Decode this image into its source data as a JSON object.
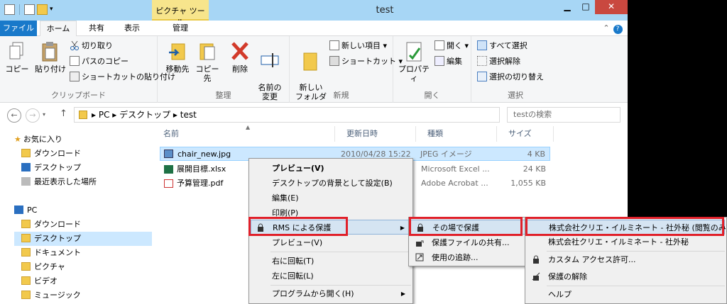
{
  "title": "test",
  "contextual_tab": "ピクチャ ツール",
  "tabs": {
    "file": "ファイル",
    "home": "ホーム",
    "share": "共有",
    "view": "表示",
    "manage": "管理"
  },
  "window_controls": {
    "minimize": "▁",
    "maximize": "□",
    "close": "✕"
  },
  "ribbon": {
    "clipboard": {
      "label": "クリップボード",
      "copy": "コピー",
      "paste": "貼り付け",
      "cut": "切り取り",
      "copy_path": "パスのコピー",
      "paste_shortcut": "ショートカットの貼り付け"
    },
    "organize": {
      "label": "整理",
      "move_to": "移動先",
      "copy_to": "コピー先",
      "delete": "削除",
      "rename": "名前の\n変更"
    },
    "new": {
      "label": "新規",
      "new_folder": "新しい\nフォルダー",
      "new_item": "新しい項目 ▾",
      "shortcut": "ショートカット ▾"
    },
    "open": {
      "label": "開く",
      "properties": "プロパティ",
      "open": "開く ▾",
      "edit": "編集"
    },
    "select": {
      "label": "選択",
      "select_all": "すべて選択",
      "select_none": "選択解除",
      "invert": "選択の切り替え"
    }
  },
  "address": {
    "path": "▸  PC  ▸  デスクトップ  ▸  test",
    "search_placeholder": "testの検索"
  },
  "nav": {
    "favorites": "お気に入り",
    "fav_items": [
      "ダウンロード",
      "デスクトップ",
      "最近表示した場所"
    ],
    "pc": "PC",
    "pc_items": [
      "ダウンロード",
      "デスクトップ",
      "ドキュメント",
      "ピクチャ",
      "ビデオ",
      "ミュージック"
    ]
  },
  "columns": {
    "name": "名前",
    "date": "更新日時",
    "type": "種類",
    "size": "サイズ"
  },
  "files": [
    {
      "name": "chair_new.jpg",
      "date": "2010/04/28 15:22",
      "type": "JPEG イメージ",
      "size": "4 KB"
    },
    {
      "name": "展開目標.xlsx",
      "date": "",
      "type": "Microsoft Excel ...",
      "size": "24 KB"
    },
    {
      "name": "予算管理.pdf",
      "date": "",
      "type": "Adobe Acrobat ...",
      "size": "1,055 KB"
    }
  ],
  "context_menu": [
    "プレビュー(V)",
    "デスクトップの背景として設定(B)",
    "編集(E)",
    "印刷(P)",
    "RMS による保護",
    "プレビュー(V)",
    "右に回転(T)",
    "左に回転(L)",
    "プログラムから開く(H)"
  ],
  "rms_menu": [
    "その場で保護",
    "保護ファイルの共有...",
    "使用の追跡..."
  ],
  "template_menu": [
    "株式会社クリエ・イルミネート - 社外秘 (閲覧のみ)",
    "株式会社クリエ・イルミネート - 社外秘",
    "カスタム アクセス許可...",
    "保護の解除",
    "ヘルプ"
  ]
}
